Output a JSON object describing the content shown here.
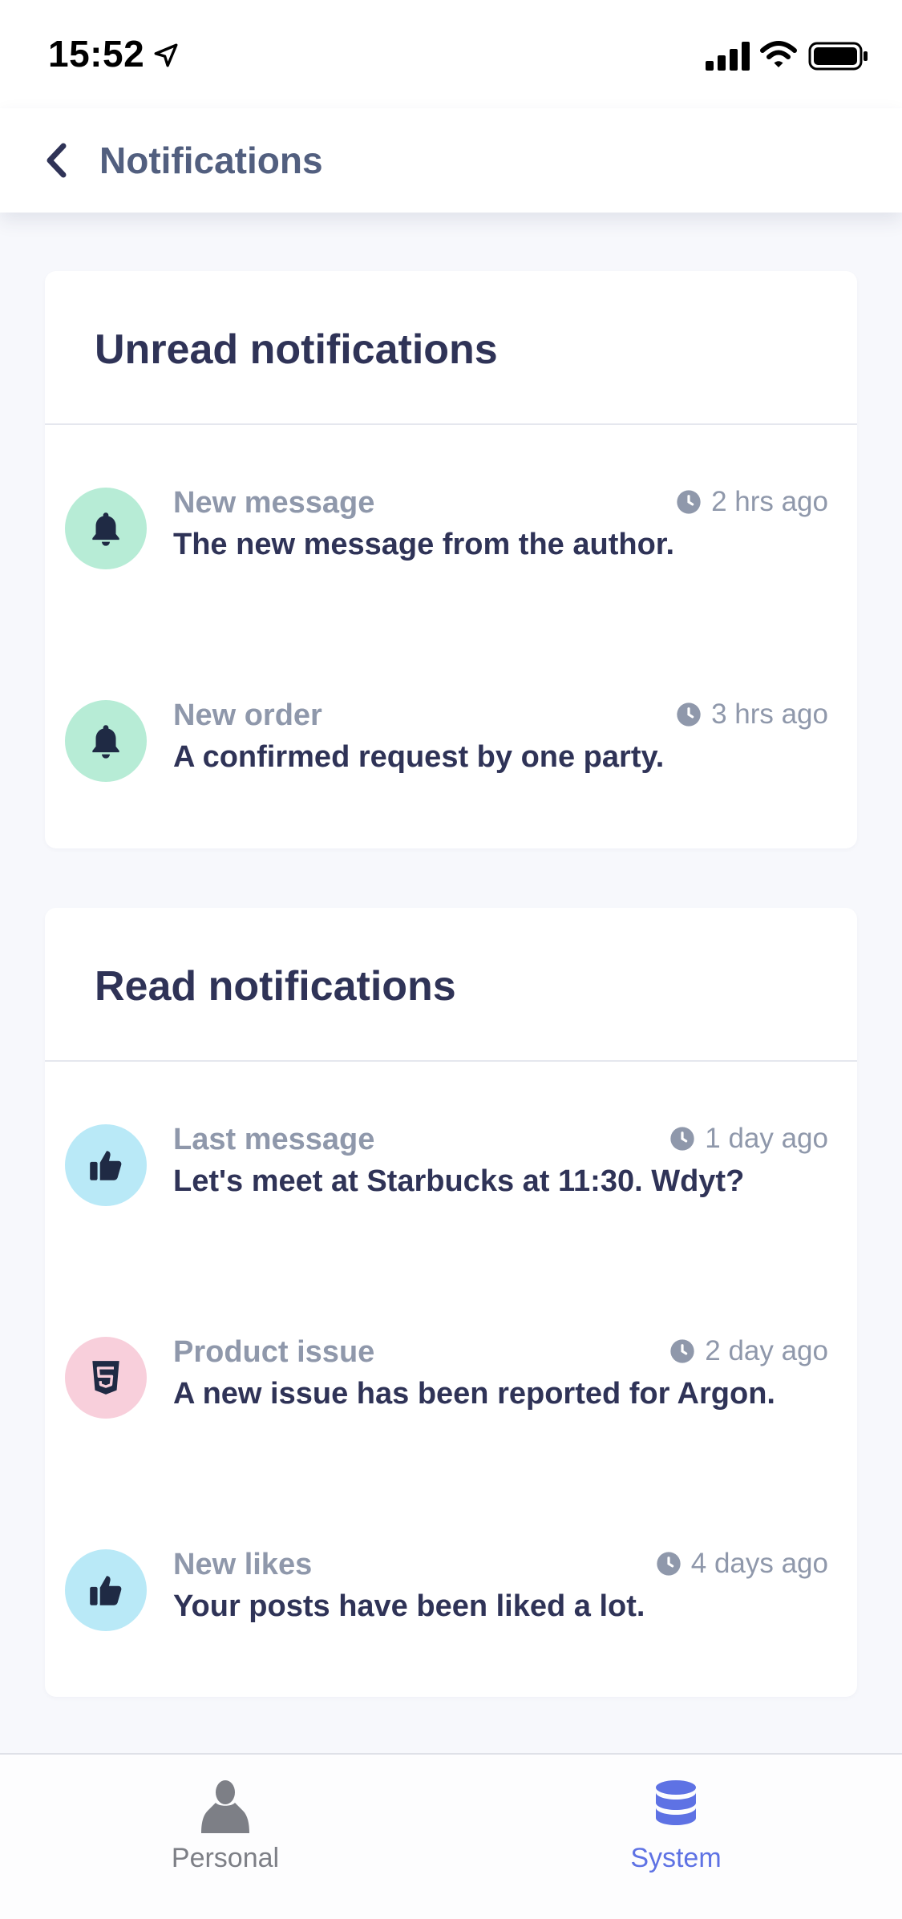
{
  "status_bar": {
    "time": "15:52"
  },
  "header": {
    "title": "Notifications"
  },
  "unread": {
    "title": "Unread notifications",
    "items": [
      {
        "title": "New message",
        "time": "2 hrs ago",
        "body": "The new message from the author.",
        "icon": "bell-icon",
        "icon_bg": "#b7ecd6"
      },
      {
        "title": "New order",
        "time": "3 hrs ago",
        "body": "A confirmed request by one party.",
        "icon": "bell-icon",
        "icon_bg": "#b7ecd6"
      }
    ]
  },
  "read": {
    "title": "Read notifications",
    "items": [
      {
        "title": "Last message",
        "time": "1 day ago",
        "body": "Let's meet at Starbucks at 11:30. Wdyt?",
        "icon": "thumbs-up-icon",
        "icon_bg": "#b9e9f7"
      },
      {
        "title": "Product issue",
        "time": "2 day ago",
        "body": "A new issue has been reported for Argon.",
        "icon": "html5-icon",
        "icon_bg": "#f8cfdb"
      },
      {
        "title": "New likes",
        "time": "4 days ago",
        "body": "Your posts have been liked a lot.",
        "icon": "thumbs-up-icon",
        "icon_bg": "#b9e9f7"
      }
    ]
  },
  "tab_bar": {
    "tabs": [
      {
        "label": "Personal",
        "icon": "person-icon",
        "active": false
      },
      {
        "label": "System",
        "icon": "database-icon",
        "active": true
      }
    ]
  },
  "colors": {
    "title": "#2f3357",
    "muted": "#8f98ab",
    "active_tab": "#5e72e4",
    "inactive_tab": "#7d7f86",
    "background": "#f7f8fc"
  }
}
